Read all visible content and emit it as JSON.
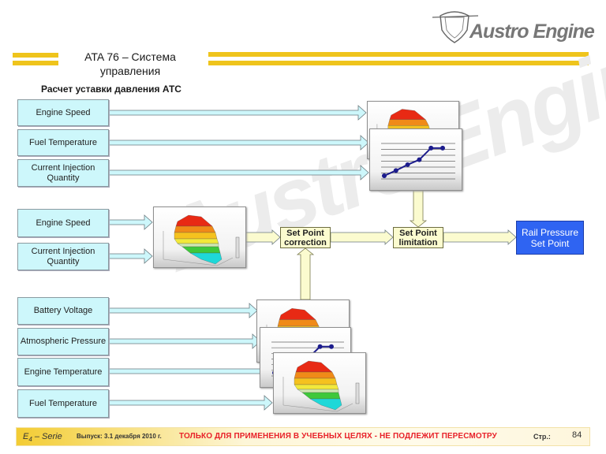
{
  "header": {
    "title": "ATA 76 – Система управления",
    "subtitle": "Расчет уставки давления АТС",
    "logo_text": "Austro Engine",
    "logo_icon": "shield-logo-icon",
    "stripe_color": "#efc41c"
  },
  "watermark": "Austro Engine",
  "inputs": {
    "group1": [
      {
        "label": "Engine Speed"
      },
      {
        "label": "Fuel Temperature"
      },
      {
        "label": "Current Injection Quantity"
      }
    ],
    "group2": [
      {
        "label": "Engine Speed"
      },
      {
        "label": "Current Injection Quantity"
      }
    ],
    "group3": [
      {
        "label": "Battery Voltage"
      },
      {
        "label": "Atmospheric Pressure"
      },
      {
        "label": "Engine Temperature"
      },
      {
        "label": "Fuel Temperature"
      }
    ]
  },
  "maps": {
    "map_icon": "3d-surface-map-icon",
    "curve_icon": "line-curve-chart-icon",
    "curve_points": [
      0.0,
      0.18,
      0.38,
      0.55,
      0.95,
      0.95
    ]
  },
  "blocks": {
    "correction": "Set Point correction",
    "limitation": "Set Point limitation",
    "output": "Rail Pressure Set Point"
  },
  "colors": {
    "input_fill": "#cdf7fb",
    "block_fill": "#fbfbcf",
    "output_fill": "#2f64f2",
    "warning_text": "#e8222a"
  },
  "footer": {
    "series": "E",
    "series_sub": "4",
    "series_suffix": " – Serie",
    "issue": "Выпуск: 3.1 декабря 2010 г.",
    "warning": "ТОЛЬКО ДЛЯ ПРИМЕНЕНИЯ В УЧЕБНЫХ ЦЕЛЯХ - НЕ ПОДЛЕЖИТ ПЕРЕСМОТРУ",
    "page_label": "Стр.:",
    "page_number": "84"
  }
}
